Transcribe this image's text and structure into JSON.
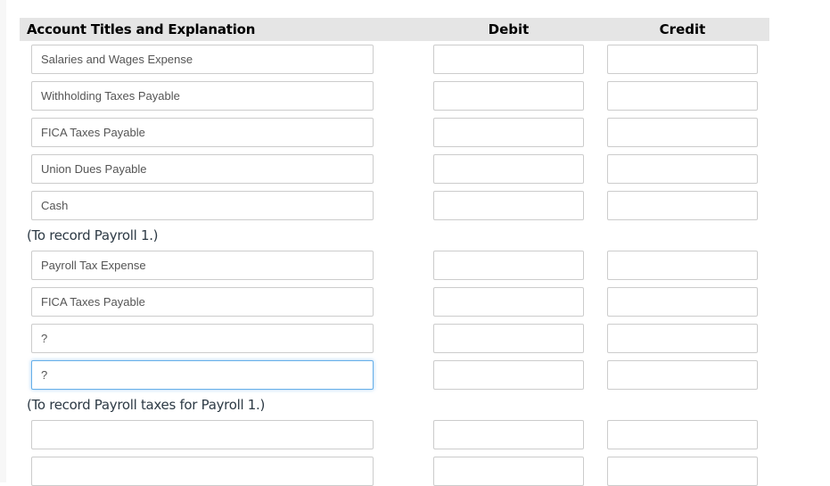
{
  "header": {
    "account_col": "Account Titles and Explanation",
    "debit_col": "Debit",
    "credit_col": "Credit"
  },
  "entries": [
    {
      "rows": [
        {
          "account": "Salaries and Wages Expense",
          "debit": "",
          "credit": ""
        },
        {
          "account": "Withholding Taxes Payable",
          "debit": "",
          "credit": ""
        },
        {
          "account": "FICA Taxes Payable",
          "debit": "",
          "credit": ""
        },
        {
          "account": "Union Dues Payable",
          "debit": "",
          "credit": ""
        },
        {
          "account": "Cash",
          "debit": "",
          "credit": ""
        }
      ],
      "note": "(To record Payroll 1.)"
    },
    {
      "rows": [
        {
          "account": "Payroll Tax Expense",
          "debit": "",
          "credit": ""
        },
        {
          "account": "FICA Taxes Payable",
          "debit": "",
          "credit": ""
        },
        {
          "account": "?",
          "debit": "",
          "credit": ""
        },
        {
          "account": "?",
          "debit": "",
          "credit": "",
          "focused": true
        }
      ],
      "note": "(To record Payroll taxes for Payroll 1.)"
    },
    {
      "rows": [
        {
          "account": "",
          "debit": "",
          "credit": ""
        },
        {
          "account": "",
          "debit": "",
          "credit": ""
        }
      ],
      "note": ""
    }
  ],
  "colors": {
    "header_bg": "#e5e5e5",
    "input_border": "#cccccc",
    "focus_border": "#66afe9",
    "note_text": "#2d3a45"
  }
}
